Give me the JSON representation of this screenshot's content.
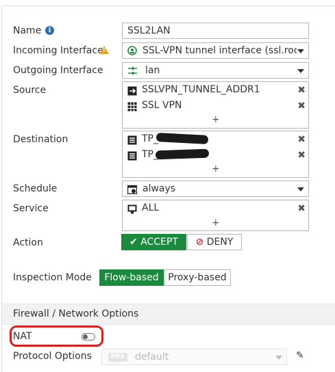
{
  "fields": {
    "name_label": "Name",
    "name_value": "SSL2LAN",
    "incoming_label": "Incoming Interface",
    "incoming_value": "SSL-VPN tunnel interface (ssl.root)",
    "outgoing_label": "Outgoing Interface",
    "outgoing_value": "lan",
    "source_label": "Source",
    "source_items": [
      "SSLVPN_TUNNEL_ADDR1",
      "SSL VPN"
    ],
    "destination_label": "Destination",
    "destination_items": [
      "TP_",
      "TP_"
    ],
    "schedule_label": "Schedule",
    "schedule_value": "always",
    "service_label": "Service",
    "service_items": [
      "ALL"
    ],
    "action_label": "Action",
    "action_accept": "ACCEPT",
    "action_deny": "DENY",
    "action_selected": "ACCEPT",
    "inspection_label": "Inspection Mode",
    "inspection_flow": "Flow-based",
    "inspection_proxy": "Proxy-based",
    "inspection_selected": "Flow-based"
  },
  "section": {
    "title": "Firewall / Network Options",
    "nat_label": "NAT",
    "nat_enabled": false,
    "protocol_label": "Protocol Options",
    "protocol_badge": "PRX",
    "protocol_value": "default"
  },
  "glyphs": {
    "remove": "✖",
    "add": "+",
    "edit": "✎",
    "check": "✔",
    "deny": "⊘"
  },
  "colors": {
    "accent_green": "#1a8a3c",
    "deny_red": "#d9322b",
    "highlight_red": "#d81f1f",
    "info_blue": "#2a6fb0",
    "warning_orange": "#e2a52b"
  }
}
